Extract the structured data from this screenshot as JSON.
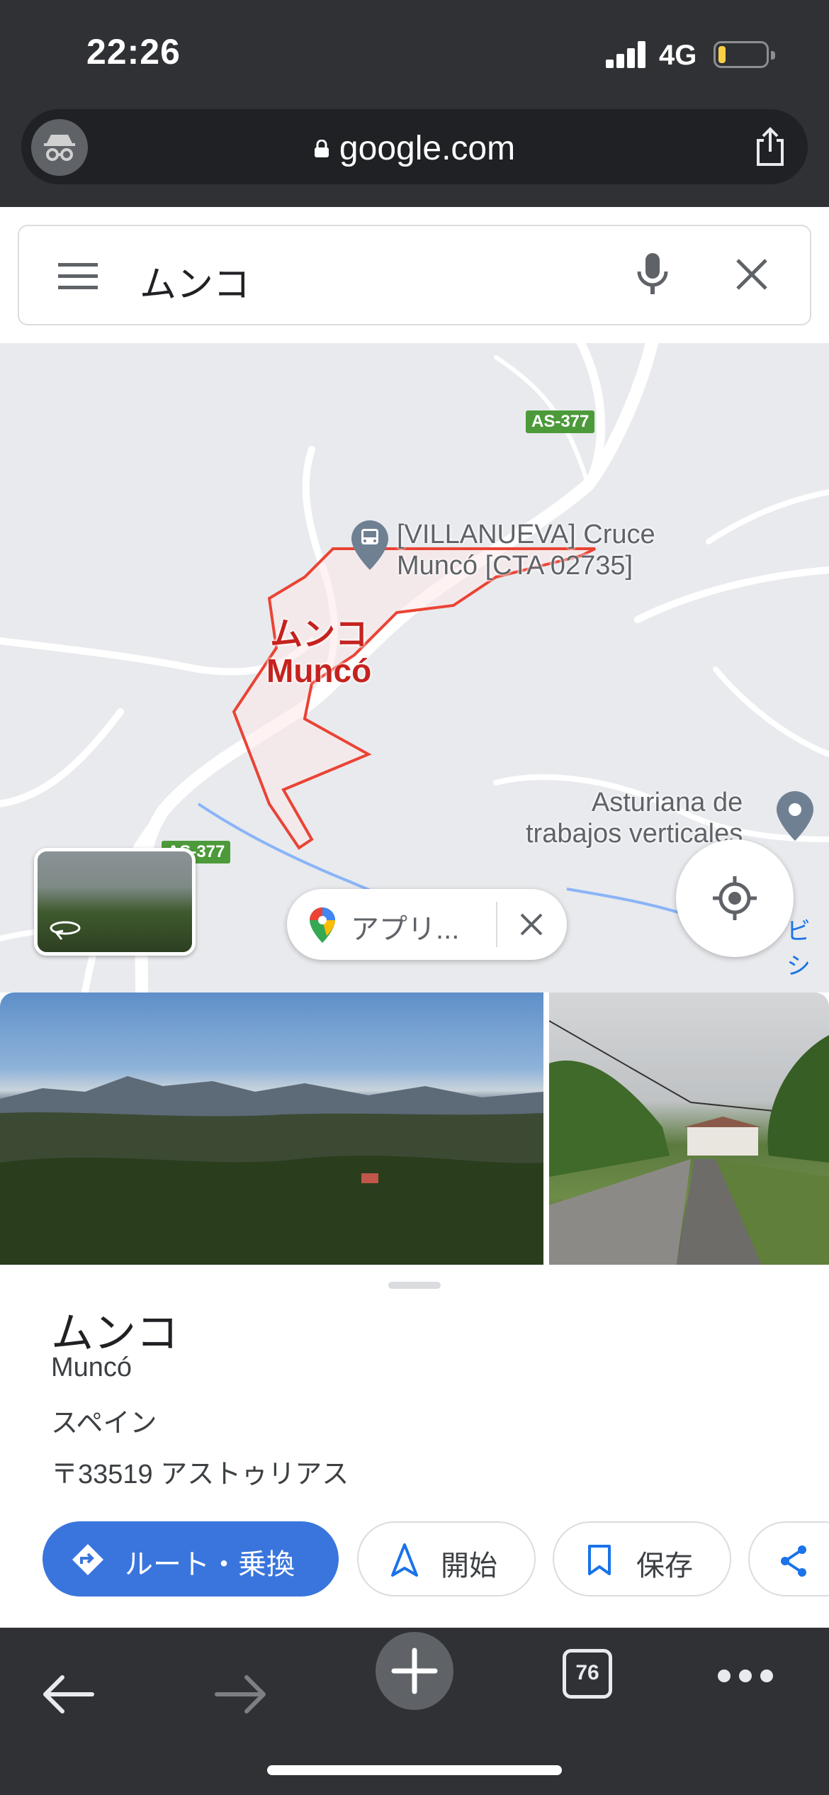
{
  "status_bar": {
    "time": "22:26",
    "network": "4G",
    "battery_level": 0.15
  },
  "browser": {
    "url": "google.com",
    "incognito_icon": "incognito-icon",
    "share_icon": "share-icon"
  },
  "search": {
    "query": "ムンコ",
    "menu_icon": "menu-icon",
    "mic_icon": "mic-icon",
    "clear_icon": "close-icon"
  },
  "map": {
    "road_labels": [
      "AS-377",
      "AS-377"
    ],
    "poi_villanueva": {
      "line1": "[VILLANUEVA] Cruce",
      "line2": "Muncó [CTA 02735]"
    },
    "place_label": {
      "line1": "ムンコ",
      "line2": "Muncó"
    },
    "poi_asturiana": {
      "line1": "Asturiana de",
      "line2": "trabajos verticales"
    },
    "edge_label": "ビシ",
    "app_chip_label": "アプリ...",
    "colors": {
      "boundary": "#ea4335",
      "place_label": "#c5221f",
      "road_sign": "#4c9a3a",
      "water": "#8ab4f8"
    }
  },
  "place": {
    "title": "ムンコ",
    "local_name": "Muncó",
    "country": "スペイン",
    "address": "〒33519 アストゥリアス",
    "actions": [
      {
        "label": "ルート・乗換",
        "icon": "directions-icon"
      },
      {
        "label": "開始",
        "icon": "navigation-icon"
      },
      {
        "label": "保存",
        "icon": "bookmark-icon"
      },
      {
        "label": "",
        "icon": "share-icon"
      }
    ],
    "accent_color": "#3a75dd"
  },
  "toolbar": {
    "tab_count": "76",
    "back_icon": "back-arrow-icon",
    "forward_icon": "forward-arrow-icon",
    "new_tab_icon": "plus-icon",
    "more_icon": "more-icon"
  }
}
